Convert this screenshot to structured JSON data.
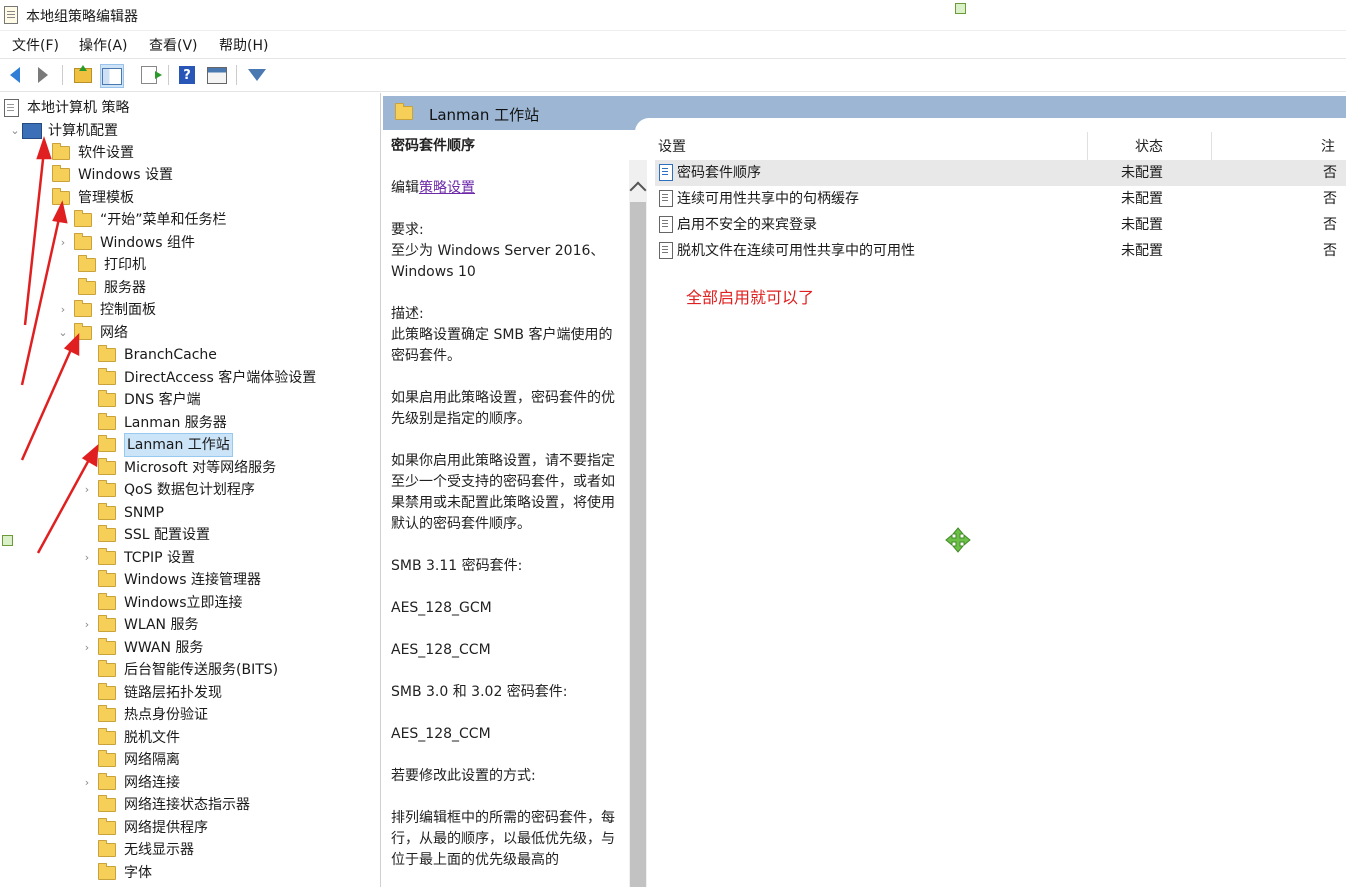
{
  "window": {
    "title": "本地组策略编辑器"
  },
  "menu": [
    "文件(F)",
    "操作(A)",
    "查看(V)",
    "帮助(H)"
  ],
  "toolbar": {
    "icons": [
      "back-arrow-icon",
      "forward-arrow-icon",
      "folder-up-icon",
      "show-hide-tree-icon",
      "export-list-icon",
      "help-icon",
      "properties-icon",
      "filter-icon"
    ]
  },
  "tree": {
    "root": "本地计算机 策略",
    "computer_config": "计算机配置",
    "software": "软件设置",
    "windows_settings": "Windows 设置",
    "admin_templates": "管理模板",
    "start_menu": "“开始”菜单和任务栏",
    "windows_components": "Windows 组件",
    "printers": "打印机",
    "server": "服务器",
    "control_panel": "控制面板",
    "network": "网络",
    "network_children": [
      "BranchCache",
      "DirectAccess 客户端体验设置",
      "DNS 客户端",
      "Lanman 服务器",
      "Lanman 工作站",
      "Microsoft 对等网络服务",
      "QoS 数据包计划程序",
      "SNMP",
      "SSL 配置设置",
      "TCPIP 设置",
      "Windows 连接管理器",
      "Windows立即连接",
      "WLAN 服务",
      "WWAN 服务",
      "后台智能传送服务(BITS)",
      "链路层拓扑发现",
      "热点身份验证",
      "脱机文件",
      "网络隔离",
      "网络连接",
      "网络连接状态指示器",
      "网络提供程序",
      "无线显示器",
      "字体"
    ]
  },
  "detail": {
    "header_title": "Lanman 工作站",
    "desc": {
      "title": "密码套件顺序",
      "edit_prefix": "编辑",
      "edit_link": "策略设置",
      "req_label": "要求:",
      "req_text": "至少为 Windows Server 2016、Windows 10",
      "desc_label": "描述:",
      "desc_text": "此策略设置确定 SMB 客户端使用的密码套件。",
      "p1": "如果启用此策略设置，密码套件的优先级别是指定的顺序。",
      "p2": "如果你启用此策略设置，请不要指定至少一个受支持的密码套件，或者如果禁用或未配置此策略设置，将使用默认的密码套件顺序。",
      "p3": "SMB 3.11 密码套件:",
      "p4": "AES_128_GCM",
      "p5": "AES_128_CCM",
      "p6": "SMB 3.0 和 3.02 密码套件:",
      "p7": "AES_128_CCM",
      "p8": "若要修改此设置的方式:",
      "p9": "排列编辑框中的所需的密码套件，每行，从最的顺序，以最低优先级，与位于最上面的优先级最高的"
    },
    "columns": {
      "setting": "设置",
      "state": "状态",
      "comment": "注释"
    },
    "rows": [
      {
        "name": "密码套件顺序",
        "state": "未配置",
        "comment": "否"
      },
      {
        "name": "连续可用性共享中的句柄缓存",
        "state": "未配置",
        "comment": "否"
      },
      {
        "name": "启用不安全的来宾登录",
        "state": "未配置",
        "comment": "否"
      },
      {
        "name": "脱机文件在连续可用性共享中的可用性",
        "state": "未配置",
        "comment": "否"
      }
    ],
    "note": "全部启用就可以了"
  }
}
